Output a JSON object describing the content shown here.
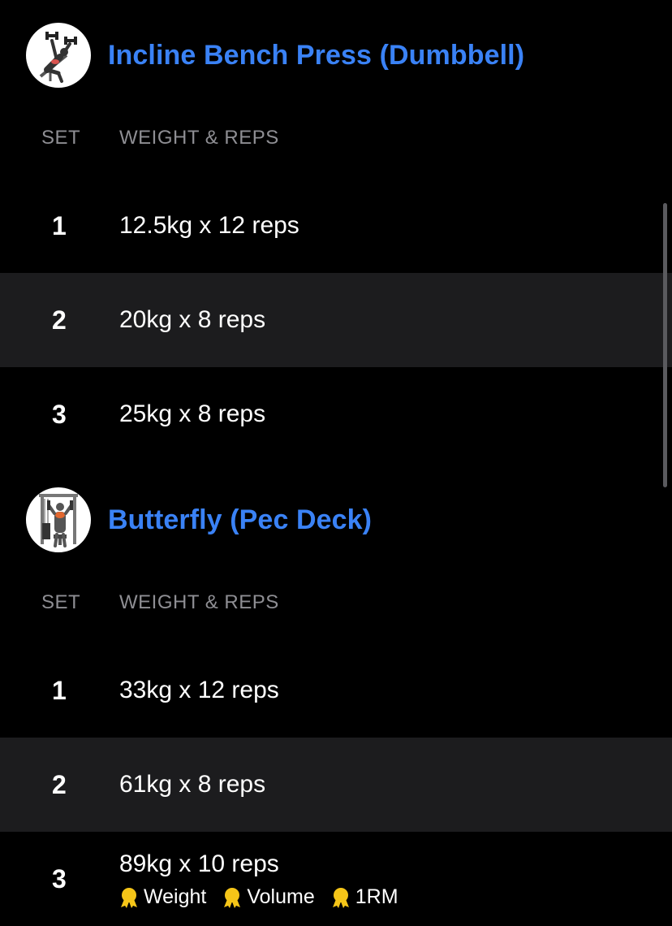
{
  "colors": {
    "accent": "#3a82f6",
    "background": "#000000",
    "alt_row": "#1c1c1e",
    "muted_text": "#8e8e93",
    "badge_gold": "#f5c518"
  },
  "exercises": [
    {
      "title": "Incline Bench Press (Dumbbell)",
      "thumbnail_icon": "incline-dumbbell-press-illustration",
      "col_set": "SET",
      "col_weight_reps": "WEIGHT & REPS",
      "sets": [
        {
          "num": "1",
          "value": "12.5kg x 12 reps"
        },
        {
          "num": "2",
          "value": "20kg x 8 reps"
        },
        {
          "num": "3",
          "value": "25kg x 8 reps"
        }
      ]
    },
    {
      "title": "Butterfly (Pec Deck)",
      "thumbnail_icon": "pec-deck-machine-illustration",
      "col_set": "SET",
      "col_weight_reps": "WEIGHT & REPS",
      "sets": [
        {
          "num": "1",
          "value": "33kg x 12 reps"
        },
        {
          "num": "2",
          "value": "61kg x 8 reps"
        },
        {
          "num": "3",
          "value": "89kg x 10 reps",
          "badges": [
            {
              "label": "Weight",
              "icon": "medal-icon"
            },
            {
              "label": "Volume",
              "icon": "medal-icon"
            },
            {
              "label": "1RM",
              "icon": "medal-icon"
            }
          ]
        }
      ]
    }
  ]
}
